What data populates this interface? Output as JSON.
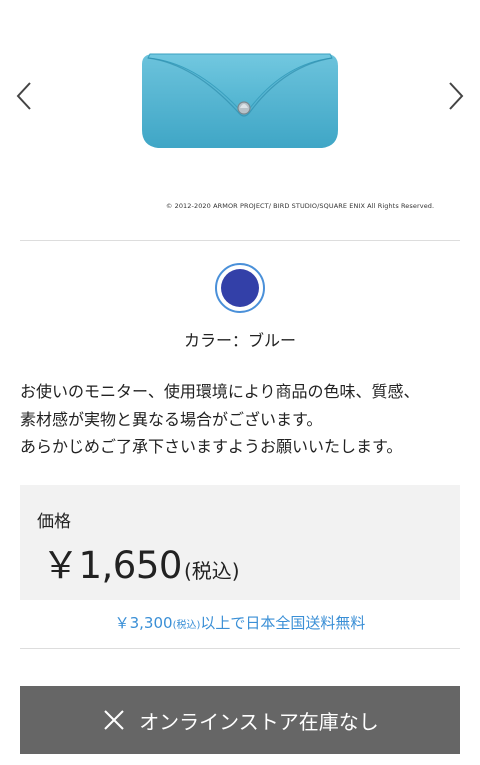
{
  "carousel": {
    "prev_icon": "chevron-left-icon",
    "next_icon": "chevron-right-icon",
    "product_color": "#4fb3d0",
    "copyright": "© 2012-2020 ARMOR PROJECT/ BIRD STUDIO/SQUARE ENIX All Rights Reserved."
  },
  "color_option": {
    "swatch_color": "#3340a8",
    "label": "カラー：ブルー"
  },
  "notice": {
    "line1": "お使いのモニター、使用環境により商品の色味、質感、",
    "line2": "素材感が実物と異なる場合がございます。",
    "line3": "あらかじめご了承下さいますようお願いいたします。"
  },
  "price": {
    "label": "価格",
    "value": "￥1,650",
    "tax": "(税込)"
  },
  "shipping": {
    "threshold": "￥3,300",
    "tax_note": "(税込)",
    "text": "以上で日本全国送料無料",
    "color": "#3a8fd6"
  },
  "stock_button": {
    "icon": "close-icon",
    "label": "オンラインストア在庫なし"
  }
}
